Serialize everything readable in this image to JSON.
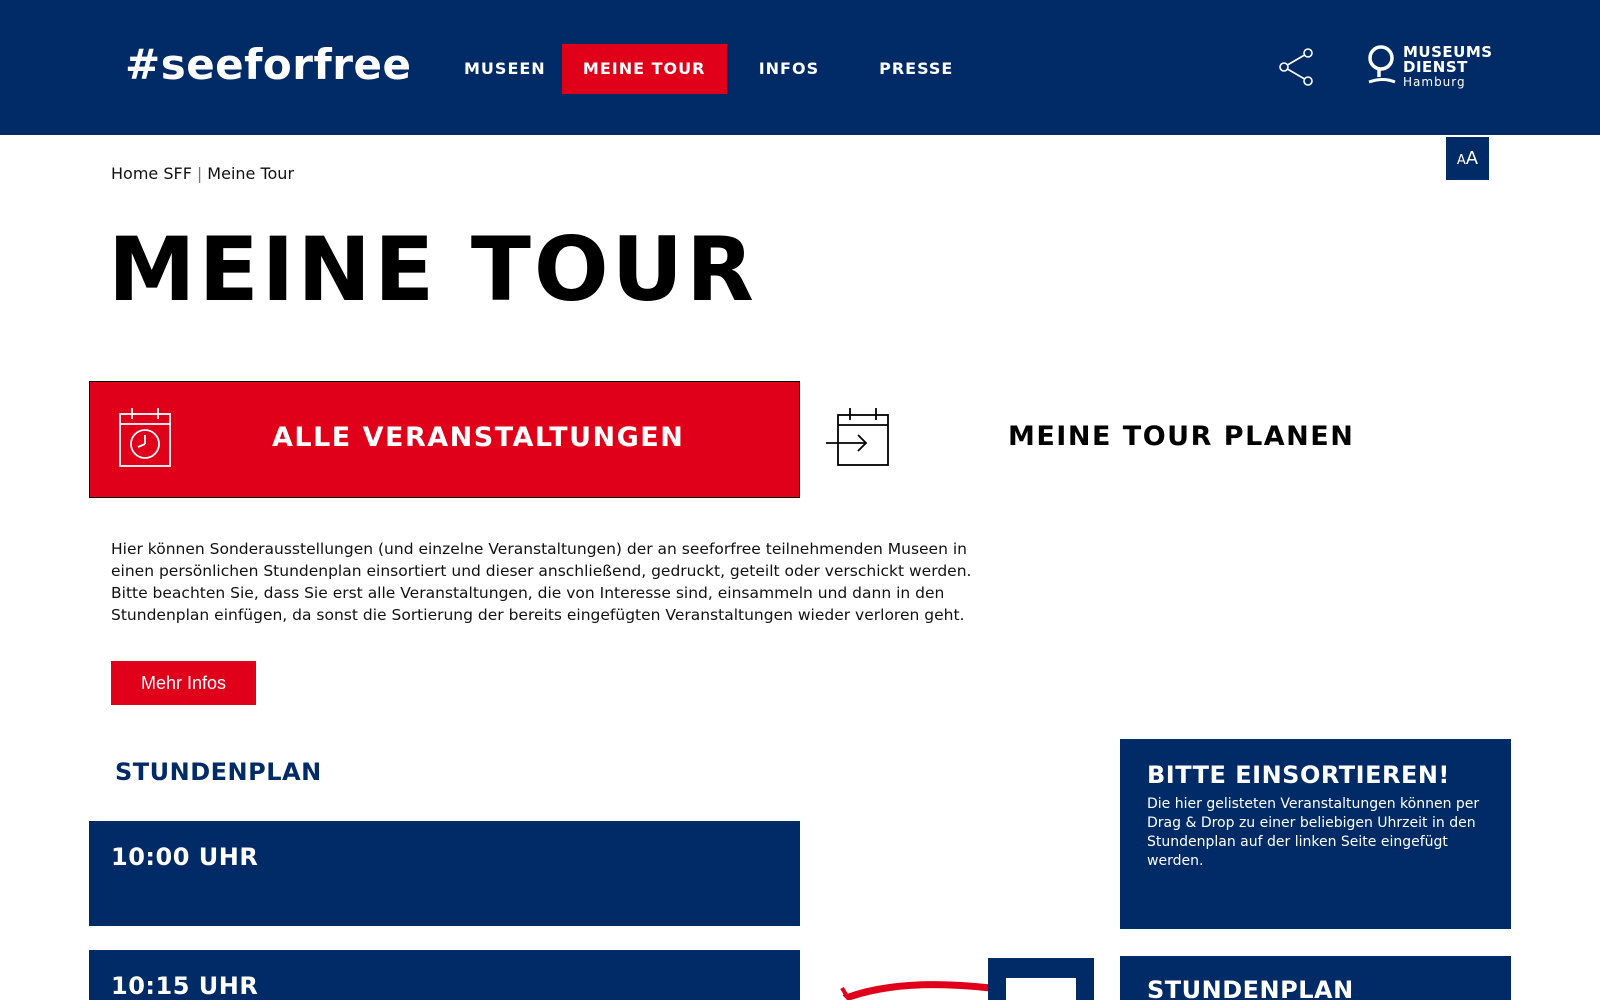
{
  "header": {
    "logo": "#seeforfree",
    "nav": [
      {
        "label": "MUSEEN",
        "active": false
      },
      {
        "label": "MEINE TOUR",
        "active": true
      },
      {
        "label": "INFOS",
        "active": false
      },
      {
        "label": "PRESSE",
        "active": false
      }
    ],
    "share_icon": "share-icon",
    "museumsdienst_logo": {
      "line1": "MUSEUMS",
      "line2": "DIENST",
      "line3": "Hamburg"
    }
  },
  "font_size_toggle": {
    "small": "A",
    "large": "A"
  },
  "breadcrumb": {
    "home": "Home SFF",
    "separator": "|",
    "current": "Meine Tour"
  },
  "page_title": "Meine Tour",
  "tabs": [
    {
      "label": "Alle Veranstaltungen",
      "icon": "calendar-clock-icon",
      "active": true
    },
    {
      "label": "Meine Tour planen",
      "icon": "calendar-arrow-icon",
      "active": false
    }
  ],
  "intro": {
    "text": "Hier können Sonderausstellungen (und einzelne Veranstaltungen) der an seeforfree teilnehmenden Museen in einen persönlichen Stundenplan einsortiert und dieser anschließend, gedruckt, geteilt oder verschickt werden. Bitte beachten Sie, dass Sie erst alle Veranstaltungen, die von Interesse sind, einsammeln und dann in den Stundenplan einfügen, da sonst die Sortierung der bereits eingefügten Veranstaltungen wieder verloren geht.",
    "more_button": "Mehr Infos"
  },
  "stundenplan": {
    "heading": "Stundenplan",
    "slots": [
      {
        "time": "10:00 Uhr"
      },
      {
        "time": "10:15 Uhr"
      }
    ]
  },
  "sidebar": {
    "sort_title": "Bitte einsortieren!",
    "sort_text": "Die hier gelisteten Veranstaltungen können per Drag & Drop zu einer beliebigen Uhrzeit in den Stundenplan auf der linken Seite eingefügt werden.",
    "second_title": "Stundenplan"
  },
  "colors": {
    "navy": "#002b66",
    "red": "#e1001a"
  }
}
